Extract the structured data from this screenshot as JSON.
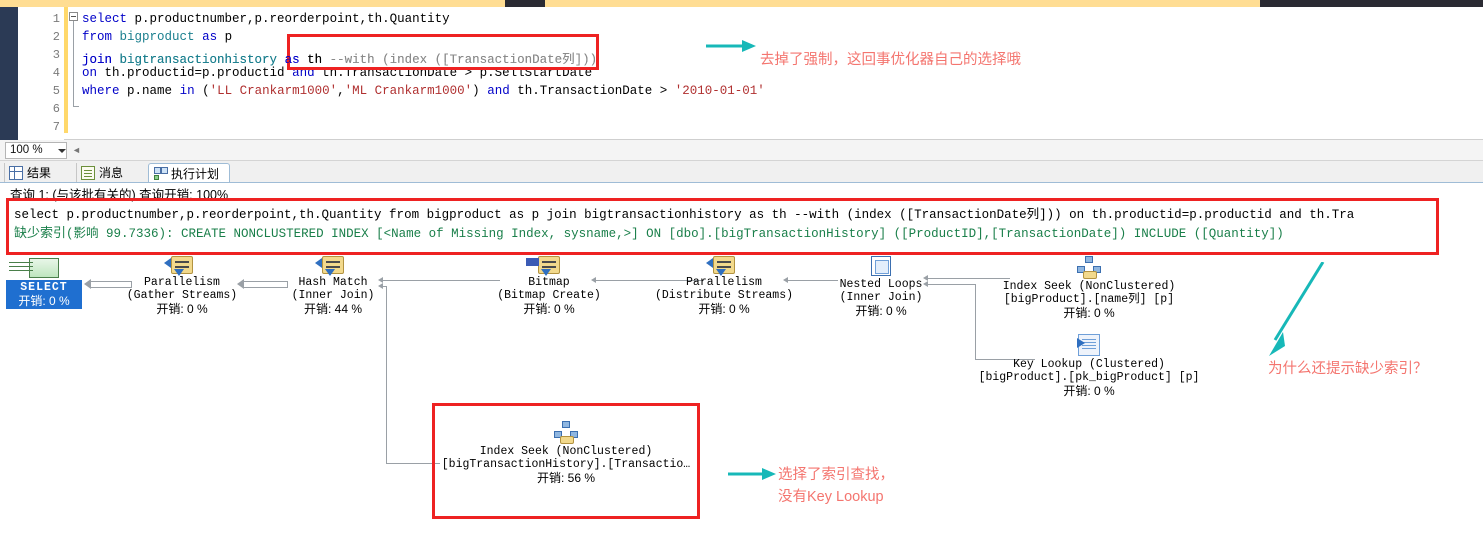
{
  "window": {
    "title_strip": ""
  },
  "editor": {
    "line_numbers": [
      "1",
      "2",
      "3",
      "4",
      "5",
      "6",
      "7"
    ],
    "lines": [
      "select p.productnumber,p.reorderpoint,th.Quantity",
      "from bigproduct as p",
      "join bigtransactionhistory as th --with (index ([TransactionDate列]))",
      "on th.productid=p.productid and th.TransactionDate > p.SellStartDate",
      "where p.name in ('LL Crankarm1000','ML Crankarm1000') and th.TransactionDate > '2010-01-01'",
      "",
      ""
    ],
    "line3_code": "join bigtransactionhistory as th ",
    "line3_comment": "--with (index ([TransactionDate列]))",
    "line4_visible": "on th.productid=p.productid and",
    "line4_masked": " th.TransactionDate > p.SellStartDate"
  },
  "zoombar": {
    "zoom_level": "100 %",
    "dropdown_icon": "chevron-down-icon"
  },
  "tabs": [
    {
      "label": "结果",
      "icon": "grid-icon",
      "active": false
    },
    {
      "label": "消息",
      "icon": "message-icon",
      "active": false
    },
    {
      "label": "执行计划",
      "icon": "execution-plan-icon",
      "active": true
    }
  ],
  "query_cost_caption": "查询 1: (与该批有关的) 查询开销: 100%",
  "plan_sql": "select p.productnumber,p.reorderpoint,th.Quantity from bigproduct as p join bigtransactionhistory as th --with (index ([TransactionDate列])) on th.productid=p.productid and th.Tra",
  "missing_index": {
    "prefix_zh": "缺少索引",
    "impact_label": "(影响 99.7336):",
    "statement": "CREATE NONCLUSTERED INDEX [<Name of Missing Index, sysname,>] ON [dbo].[bigTransactionHistory] ([ProductID],[TransactionDate]) INCLUDE ([Quantity])"
  },
  "plan_nodes": [
    {
      "id": "select",
      "label": "SELECT",
      "sub": "",
      "cost": "开销: 0 %",
      "icon": "select-result-icon",
      "selected": true
    },
    {
      "id": "par-gather",
      "label": "Parallelism",
      "sub": "(Gather Streams)",
      "cost": "开销: 0 %",
      "icon": "parallelism-icon",
      "selected": false
    },
    {
      "id": "hash-match",
      "label": "Hash Match",
      "sub": "(Inner Join)",
      "cost": "开销: 44 %",
      "icon": "hash-match-icon",
      "selected": false
    },
    {
      "id": "bitmap",
      "label": "Bitmap",
      "sub": "(Bitmap Create)",
      "cost": "开销: 0 %",
      "icon": "bitmap-icon",
      "selected": false
    },
    {
      "id": "par-dist",
      "label": "Parallelism",
      "sub": "(Distribute Streams)",
      "cost": "开销: 0 %",
      "icon": "parallelism-icon",
      "selected": false
    },
    {
      "id": "nested",
      "label": "Nested Loops",
      "sub": "(Inner Join)",
      "cost": "开销: 0 %",
      "icon": "nested-loops-icon",
      "selected": false
    },
    {
      "id": "seek-prod",
      "label": "Index Seek (NonClustered)",
      "sub": "[bigProduct].[name列] [p]",
      "cost": "开销: 0 %",
      "icon": "index-seek-icon",
      "selected": false
    },
    {
      "id": "key-lookup",
      "label": "Key Lookup (Clustered)",
      "sub": "[bigProduct].[pk_bigProduct] [p]",
      "cost": "开销: 0 %",
      "icon": "key-lookup-icon",
      "selected": false
    },
    {
      "id": "seek-tran",
      "label": "Index Seek (NonClustered)",
      "sub": "[bigTransactionHistory].[Transactio…",
      "cost": "开销: 56 %",
      "icon": "index-seek-icon",
      "selected": false
    }
  ],
  "annotations": [
    {
      "id": "ann-hint",
      "text": "去掉了强制，这回事优化器自己的选择哦",
      "color": "#f4756f"
    },
    {
      "id": "ann-seek-line1",
      "text": "选择了索引查找，",
      "color": "#f4756f"
    },
    {
      "id": "ann-seek-line2",
      "text": "没有Key Lookup",
      "color": "#f4756f"
    },
    {
      "id": "ann-missing",
      "text": "为什么还提示缺少索引？",
      "color": "#f4756f"
    }
  ],
  "colors": {
    "highlight_box": "#ee2222",
    "arrow": "#17b8b8",
    "annotation": "#f4756f",
    "selected_node": "#1f6fd0",
    "changebar": "#ffd86b"
  }
}
